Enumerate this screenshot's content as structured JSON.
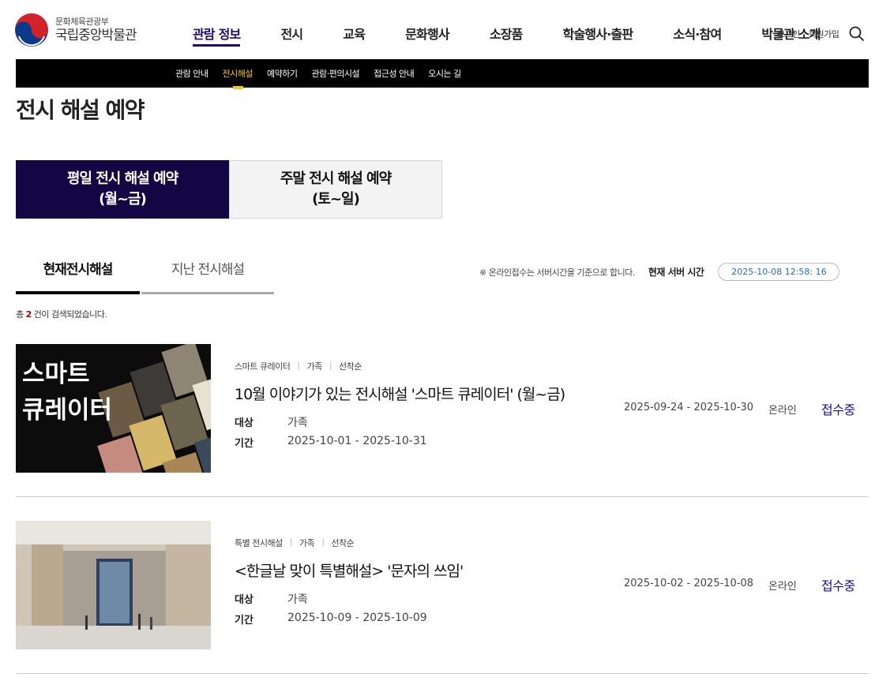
{
  "header": {
    "logo_sub": "문화체육관광부",
    "logo_main": "국립중앙박물관",
    "gnb": [
      "관람 정보",
      "전시",
      "교육",
      "문화행사",
      "소장품",
      "학술행사·출판",
      "소식·참여",
      "박물관 소개"
    ],
    "login": "로그인",
    "signup": "회원가입"
  },
  "subnav": [
    "관람 안내",
    "전시해설",
    "예약하기",
    "관람·편의시설",
    "접근성 안내",
    "오시는 길"
  ],
  "page_title": "전시 해설 예약",
  "bigtabs": {
    "weekday_line1": "평일 전시 해설 예약",
    "weekday_line2": "(월~금)",
    "weekend_line1": "주말 전시 해설 예약",
    "weekend_line2": "(토~일)"
  },
  "subtabs": {
    "current": "현재전시해설",
    "past": "지난 전시해설"
  },
  "server": {
    "note": "※ 온라인접수는 서버시간을 기준으로 합니다.",
    "label": "현재 서버 시간",
    "time": "2025-10-08 12:58: 16"
  },
  "count": {
    "prefix": "총",
    "num": "2",
    "suffix": "건이 검색되었습니다."
  },
  "labels": {
    "target": "대상",
    "period": "기간"
  },
  "thumb1_text": {
    "line1": "스마트",
    "line2": "큐레이터"
  },
  "items": [
    {
      "tags": [
        "스마트 큐레이터",
        "가족",
        "선착순"
      ],
      "title": "10월 이야기가 있는 전시해설 '스마트 큐레이터' (월~금)",
      "target": "가족",
      "dates": "2025-10-01 - 2025-10-31",
      "reg_period": "2025-09-24 - 2025-10-30",
      "method": "온라인",
      "status": "접수중"
    },
    {
      "tags": [
        "특별 전시해설",
        "가족",
        "선착순"
      ],
      "title": "<한글날 맞이 특별해설> '문자의 쓰임'",
      "target": "가족",
      "dates": "2025-10-09 - 2025-10-09",
      "reg_period": "2025-10-02 - 2025-10-08",
      "method": "온라인",
      "status": "접수중"
    }
  ],
  "colors": {
    "accent": "#130644",
    "subnav_bg": "#000000",
    "subnav_active": "#f6c51b",
    "status": "#1b0b9e"
  }
}
